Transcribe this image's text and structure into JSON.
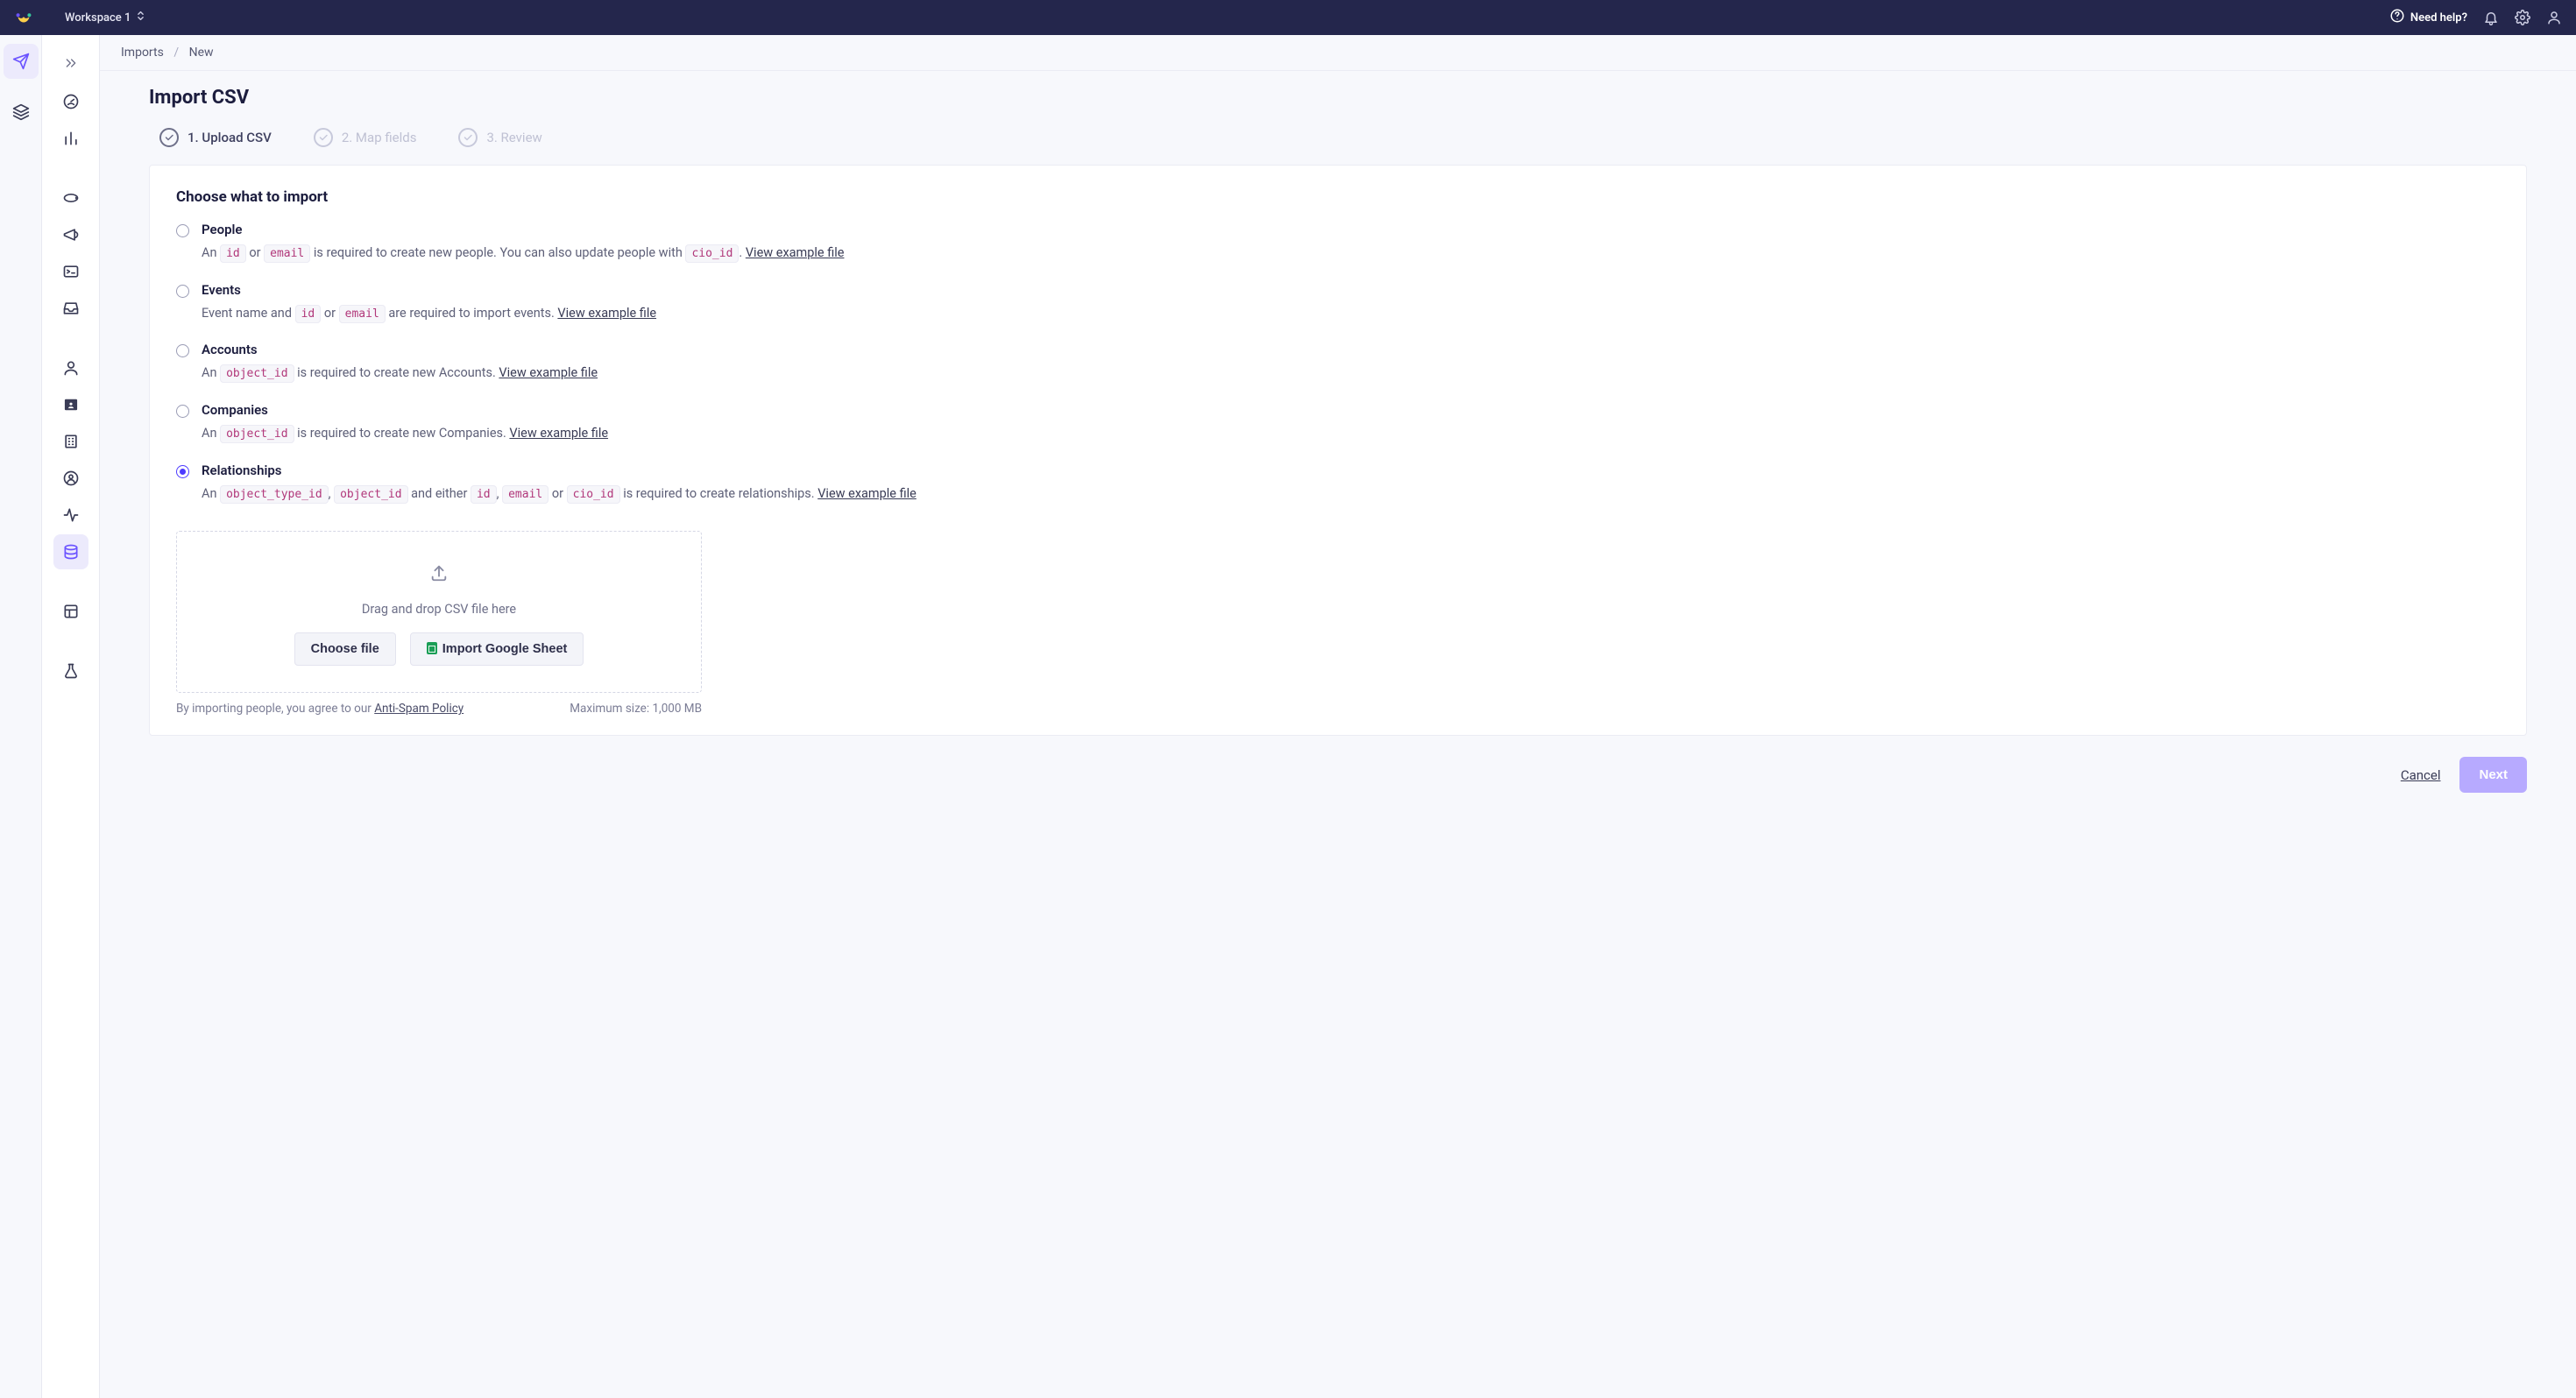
{
  "topbar": {
    "workspace": "Workspace 1",
    "need_help": "Need help?"
  },
  "breadcrumb": {
    "parent": "Imports",
    "current": "New"
  },
  "page_title": "Import CSV",
  "steps": [
    {
      "label": "1. Upload CSV"
    },
    {
      "label": "2. Map fields"
    },
    {
      "label": "3. Review"
    }
  ],
  "choose_heading": "Choose what to import",
  "options": {
    "people": {
      "title": "People",
      "desc_1": "An ",
      "tok_1": "id",
      "desc_2": " or ",
      "tok_2": "email",
      "desc_3": " is required to create new people. You can also update people with ",
      "tok_3": "cio_id",
      "desc_4": ". ",
      "link": "View example file"
    },
    "events": {
      "title": "Events",
      "desc_1": "Event name and ",
      "tok_1": "id",
      "desc_2": " or ",
      "tok_2": "email",
      "desc_3": " are required to import events. ",
      "link": "View example file"
    },
    "accounts": {
      "title": "Accounts",
      "desc_1": "An ",
      "tok_1": "object_id",
      "desc_2": " is required to create new Accounts. ",
      "link": "View example file"
    },
    "companies": {
      "title": "Companies",
      "desc_1": "An ",
      "tok_1": "object_id",
      "desc_2": " is required to create new Companies. ",
      "link": "View example file"
    },
    "relationships": {
      "title": "Relationships",
      "desc_1": "An ",
      "tok_1": "object_type_id",
      "desc_2": ", ",
      "tok_2": "object_id",
      "desc_3": " and either ",
      "tok_3": "id",
      "desc_4": ", ",
      "tok_4": "email",
      "desc_5": " or ",
      "tok_5": "cio_id",
      "desc_6": " is required to create relationships. ",
      "link": "View example file"
    }
  },
  "dropzone": {
    "text": "Drag and drop CSV file here",
    "choose_file": "Choose file",
    "import_google": "Import Google Sheet"
  },
  "footer": {
    "agree_prefix": "By importing people, you agree to our ",
    "policy_link": "Anti-Spam Policy",
    "max_size": "Maximum size: 1,000 MB"
  },
  "actions": {
    "cancel": "Cancel",
    "next": "Next"
  }
}
